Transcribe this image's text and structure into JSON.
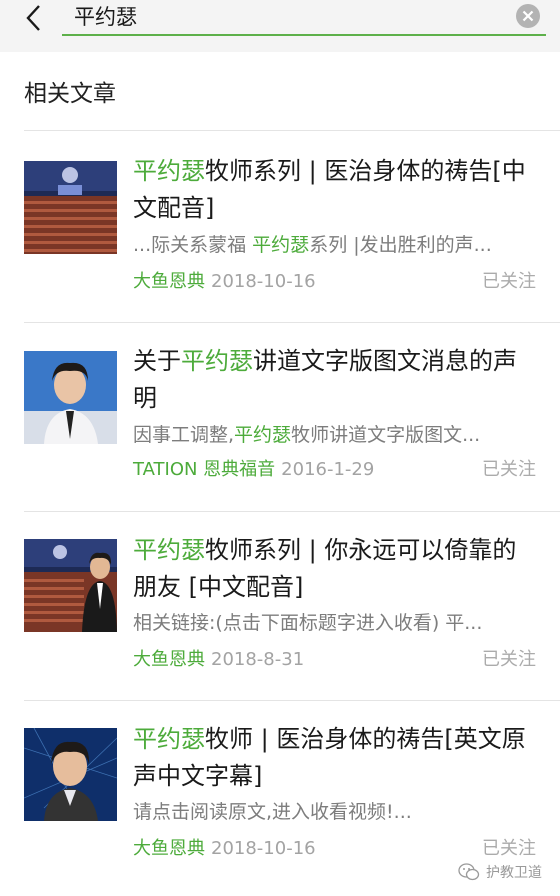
{
  "search": {
    "query": "平约瑟"
  },
  "section": {
    "title": "相关文章"
  },
  "articles": [
    {
      "title_highlight": "平约瑟",
      "title_rest": "牧师系列 | 医治身体的祷告[中文配音]",
      "snippet_pre": "...际关系蒙福 ",
      "snippet_highlight": "平约瑟",
      "snippet_post": "系列 |发出胜利的声...",
      "author": "大鱼恩典",
      "date": "2018-10-16",
      "follow": "已关注"
    },
    {
      "title_pre": "关于",
      "title_highlight": "平约瑟",
      "title_rest": "讲道文字版图文消息的声明",
      "snippet_pre": "因事工调整,",
      "snippet_highlight": "平约瑟",
      "snippet_post": "牧师讲道文字版图文...",
      "author": "TATION 恩典福音",
      "date": "2016-1-29",
      "follow": "已关注"
    },
    {
      "title_highlight": "平约瑟",
      "title_rest": "牧师系列 | 你永远可以倚靠的朋友 [中文配音]",
      "snippet_pre": "相关链接:(点击下面标题字进入收看) 平...",
      "author": "大鱼恩典",
      "date": "2018-8-31",
      "follow": "已关注"
    },
    {
      "title_highlight": "平约瑟",
      "title_rest": "牧师 | 医治身体的祷告[英文原声中文字幕]",
      "snippet_pre": "请点击阅读原文,进入收看视频!...",
      "author": "大鱼恩典",
      "date": "2018-10-16",
      "follow": "已关注"
    }
  ],
  "watermark": {
    "text": "护教卫道"
  },
  "colors": {
    "accent": "#4dab3b",
    "header_bg": "#f4f4f4",
    "divider": "#e4e4e4"
  }
}
